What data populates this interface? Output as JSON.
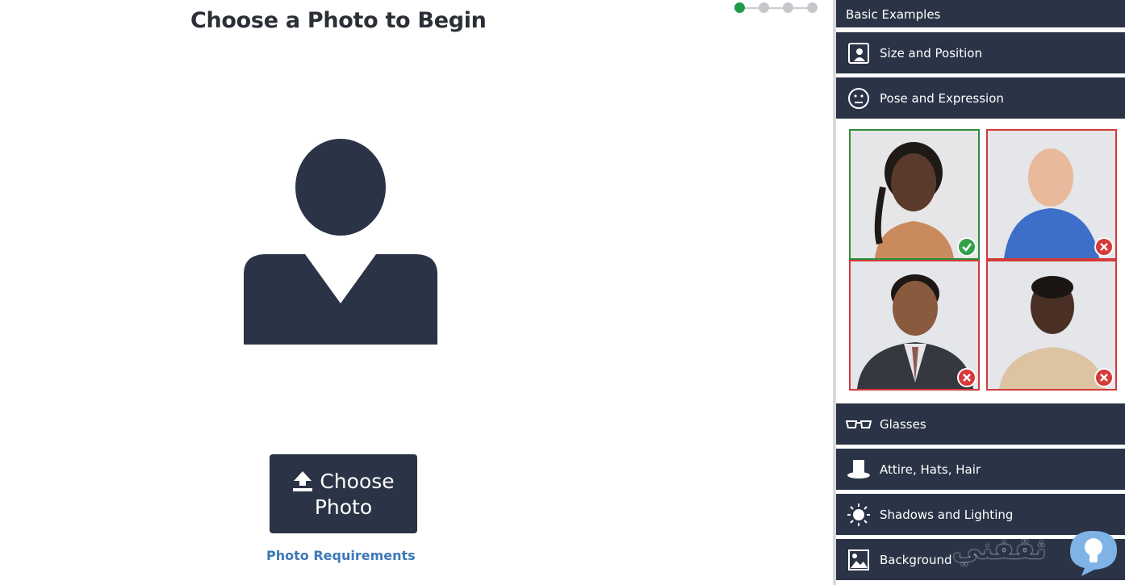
{
  "page": {
    "title": "Choose a Photo to Begin"
  },
  "steps": {
    "count": 4,
    "active_index": 0
  },
  "upload": {
    "button_line1": "Choose",
    "button_line2": "Photo",
    "requirements_link": "Photo Requirements"
  },
  "panel": {
    "header": "Basic Examples",
    "items": [
      {
        "label": "Size and Position",
        "icon": "portrait-frame-icon"
      },
      {
        "label": "Pose and Expression",
        "icon": "neutral-face-icon"
      },
      {
        "label": "Glasses",
        "icon": "glasses-icon"
      },
      {
        "label": "Attire, Hats, Hair",
        "icon": "top-hat-icon"
      },
      {
        "label": "Shadows and Lighting",
        "icon": "sun-icon"
      },
      {
        "label": "Background",
        "icon": "landscape-image-icon"
      }
    ],
    "examples": [
      {
        "status": "accepted",
        "icon": "check-icon"
      },
      {
        "status": "rejected",
        "icon": "x-icon"
      },
      {
        "status": "rejected",
        "icon": "x-icon"
      },
      {
        "status": "rejected",
        "icon": "x-icon"
      }
    ]
  },
  "watermark": {
    "text": "ثقفني"
  },
  "colors": {
    "navy": "#2a3446",
    "accent_green": "#1f9b48",
    "reject_red": "#d33a3a",
    "link_blue": "#3d78b8"
  }
}
